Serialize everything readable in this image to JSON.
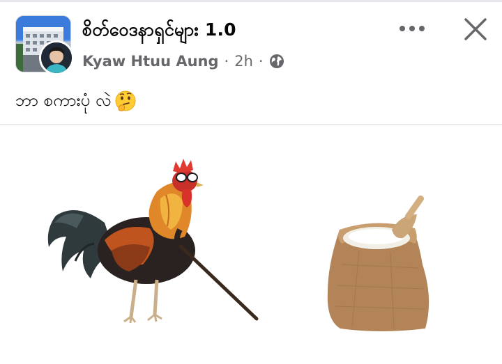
{
  "post": {
    "group_name": "စိတ်ဝေဒနာရှင်များ 1.0",
    "author": "Kyaw Htuu Aung",
    "separator": "·",
    "time": "2h",
    "privacy_icon": "globe-icon",
    "caption": "ဘာ စကားပုံ လဲ",
    "caption_emoji": "thinking-face-emoji"
  },
  "actions": {
    "more_icon": "more-horizontal-icon",
    "close_icon": "close-icon"
  },
  "colors": {
    "text_primary": "#050505",
    "text_secondary": "#65676b",
    "divider": "#e4e6eb"
  }
}
